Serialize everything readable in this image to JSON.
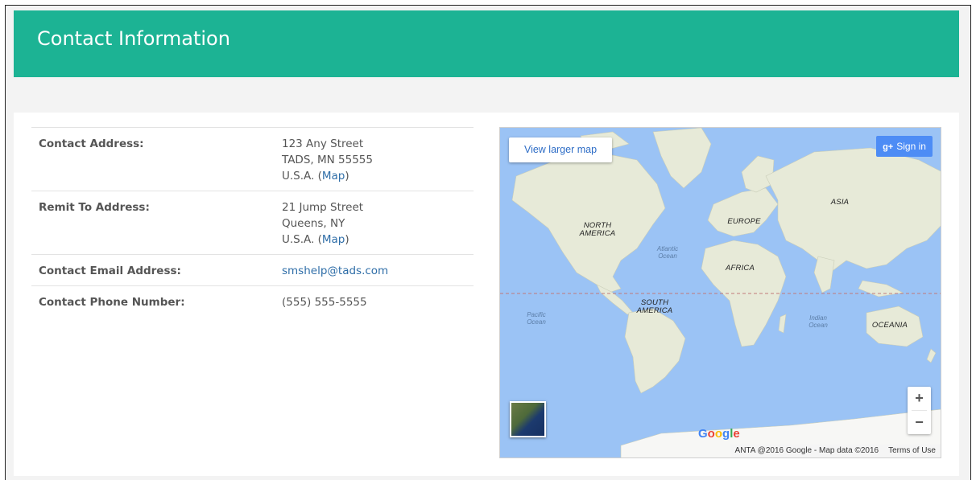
{
  "header": {
    "title": "Contact Information"
  },
  "contact": {
    "rows": [
      {
        "label": "Contact Address:",
        "lines": [
          "123 Any Street",
          "TADS, MN 55555"
        ],
        "country": "U.S.A. (",
        "map_link": "Map",
        "close": ")"
      },
      {
        "label": "Remit To Address:",
        "lines": [
          "21 Jump Street",
          "Queens, NY"
        ],
        "country": "U.S.A. (",
        "map_link": "Map",
        "close": ")"
      },
      {
        "label": "Contact Email Address:",
        "email": "smshelp@tads.com"
      },
      {
        "label": "Contact Phone Number:",
        "phone": "(555) 555-5555"
      }
    ]
  },
  "map": {
    "view_larger": "View larger map",
    "sign_in": "Sign in",
    "sign_in_icon": "g+-icon",
    "zoom_in": "+",
    "zoom_out": "−",
    "brand": "Google",
    "attribution": "ANTA @2016 Google - Map data ©2016",
    "terms": "Terms of Use",
    "labels": {
      "north_america": "NORTH AMERICA",
      "south_america": "SOUTH AMERICA",
      "europe": "EUROPE",
      "africa": "AFRICA",
      "asia": "ASIA",
      "oceania": "OCEANIA",
      "atlantic": "Atlantic Ocean",
      "pacific": "Pacific Ocean",
      "indian": "Indian Ocean"
    }
  },
  "colors": {
    "header_bg": "#1cb394",
    "link": "#2f6ea8",
    "water": "#9bc3f5",
    "land": "#e7ead8"
  }
}
